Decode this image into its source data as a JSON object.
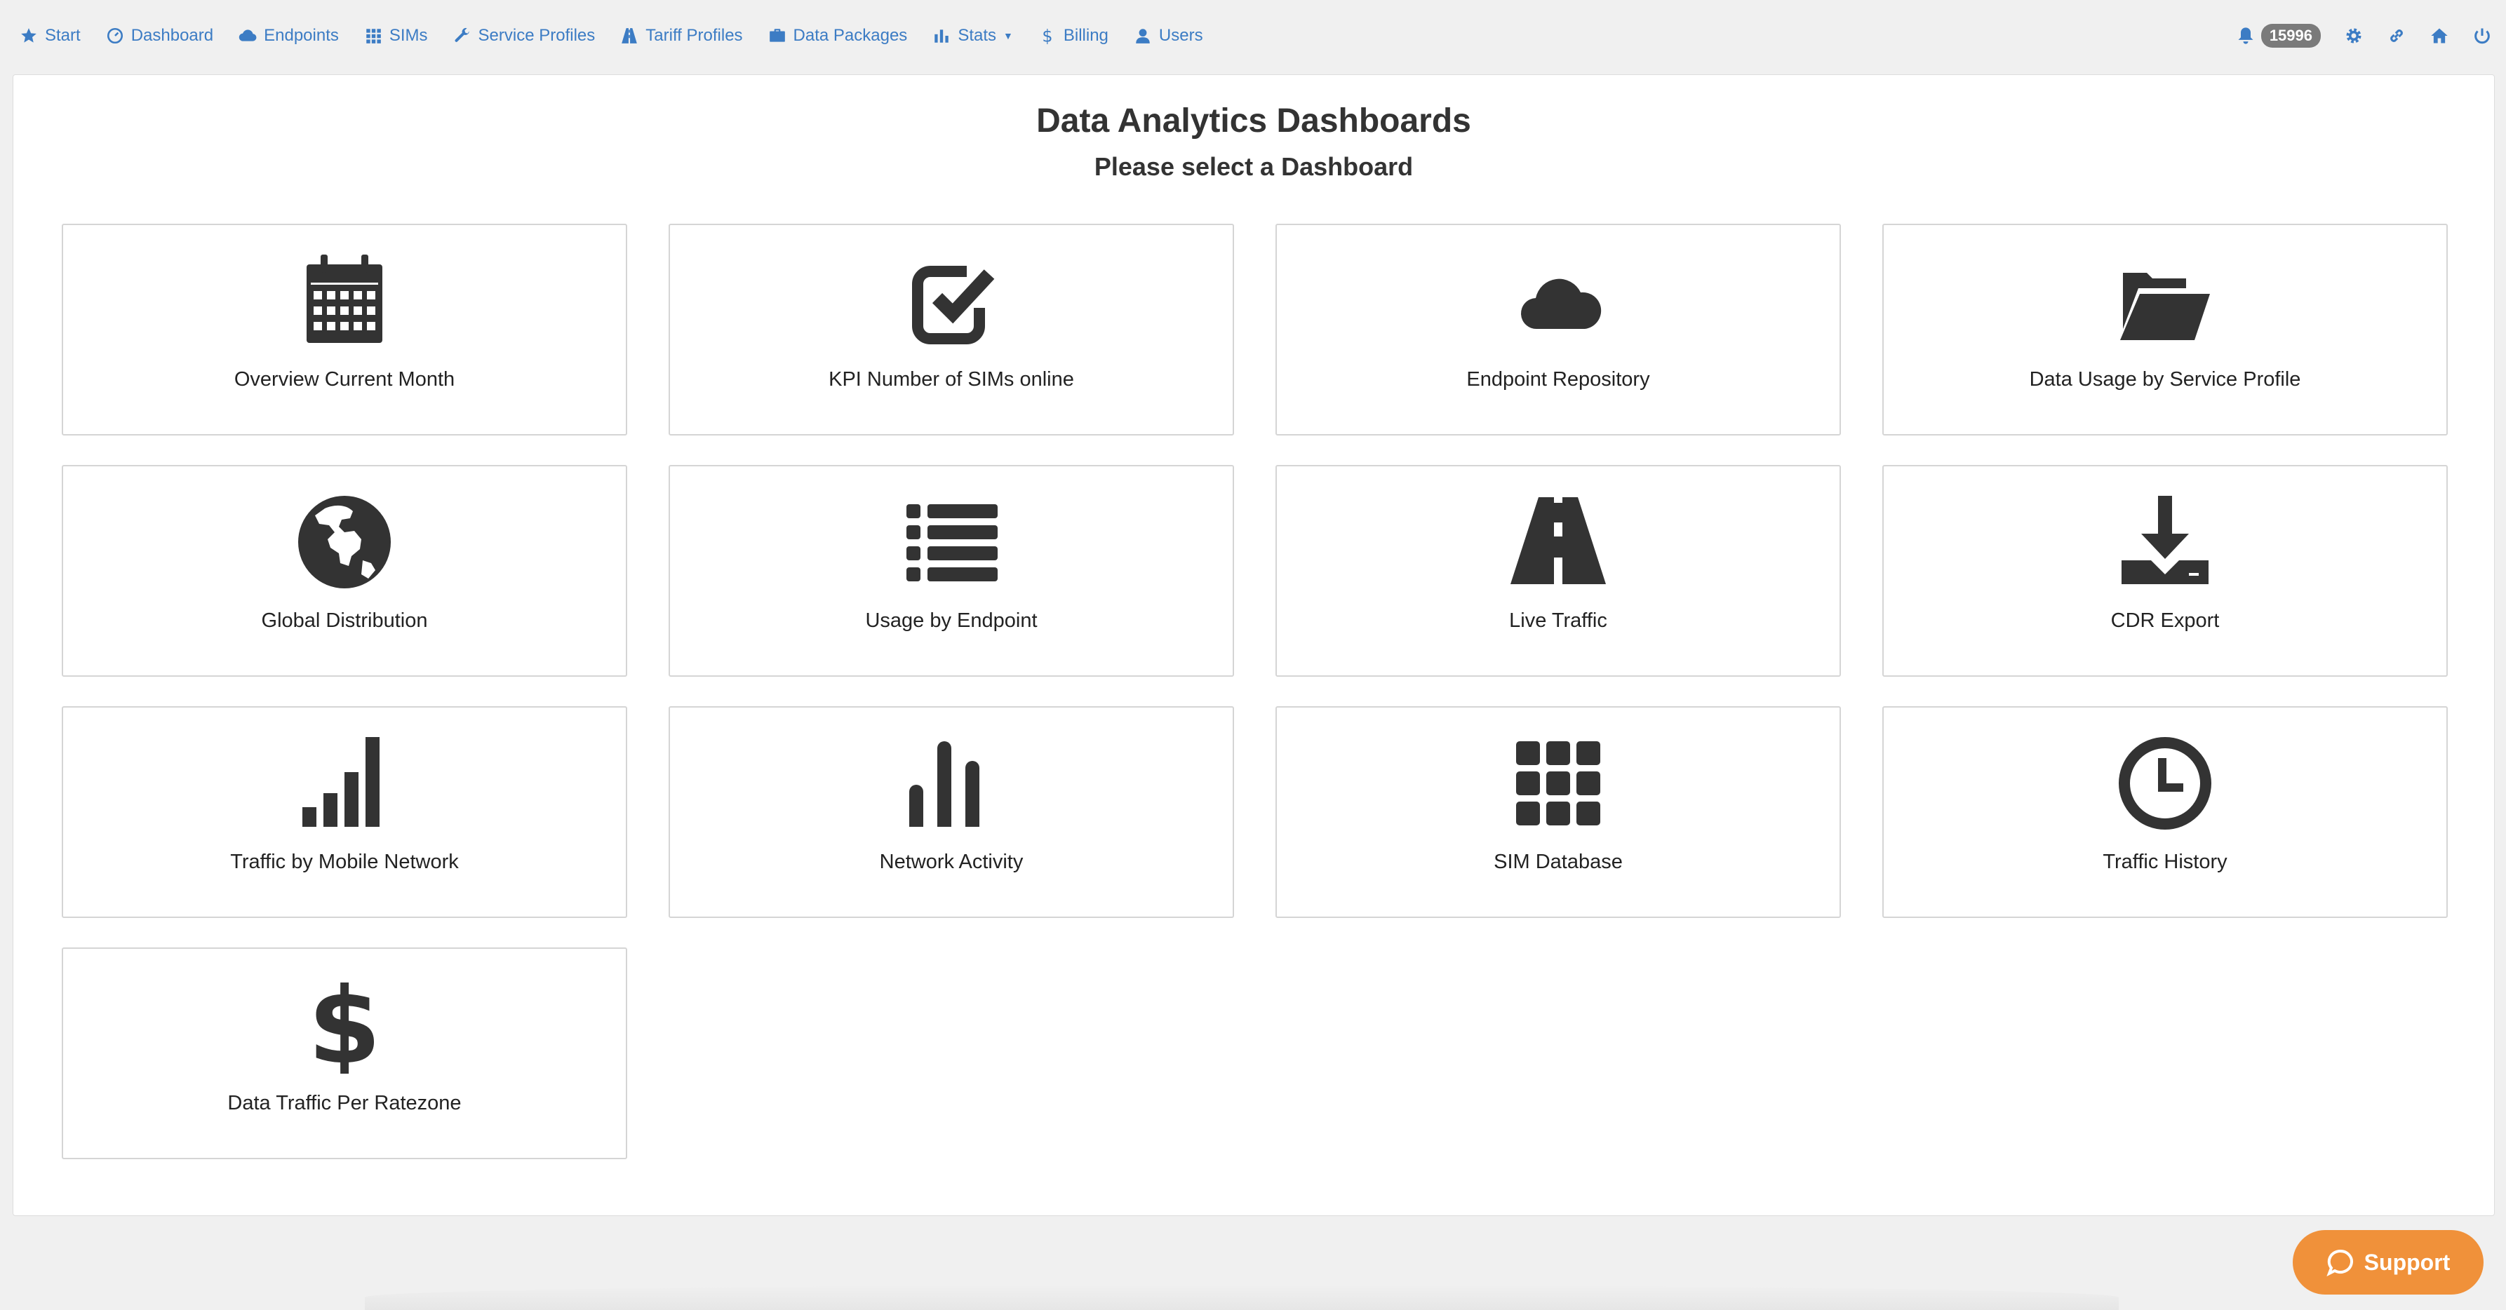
{
  "nav": {
    "items": [
      {
        "label": "Start",
        "icon": "star-icon"
      },
      {
        "label": "Dashboard",
        "icon": "dashboard-icon"
      },
      {
        "label": "Endpoints",
        "icon": "cloud-icon"
      },
      {
        "label": "SIMs",
        "icon": "grid-icon"
      },
      {
        "label": "Service Profiles",
        "icon": "wrench-icon"
      },
      {
        "label": "Tariff Profiles",
        "icon": "road-icon"
      },
      {
        "label": "Data Packages",
        "icon": "briefcase-icon"
      },
      {
        "label": "Stats",
        "icon": "bar-chart-icon"
      },
      {
        "label": "Billing",
        "icon": "dollar-icon"
      },
      {
        "label": "Users",
        "icon": "user-icon"
      }
    ],
    "notification_count": "15996",
    "link_color": "#3c7cc4"
  },
  "page": {
    "title": "Data Analytics Dashboards",
    "subtitle": "Please select a Dashboard"
  },
  "cards": [
    {
      "label": "Overview Current Month",
      "icon": "calendar-icon"
    },
    {
      "label": "KPI Number of SIMs online",
      "icon": "check-square-icon"
    },
    {
      "label": "Endpoint Repository",
      "icon": "cloud-icon"
    },
    {
      "label": "Data Usage by Service Profile",
      "icon": "folder-open-icon"
    },
    {
      "label": "Global Distribution",
      "icon": "globe-icon"
    },
    {
      "label": "Usage by Endpoint",
      "icon": "list-icon"
    },
    {
      "label": "Live Traffic",
      "icon": "road-icon"
    },
    {
      "label": "CDR Export",
      "icon": "download-icon"
    },
    {
      "label": "Traffic by Mobile Network",
      "icon": "signal-icon"
    },
    {
      "label": "Network Activity",
      "icon": "bar-chart-icon"
    },
    {
      "label": "SIM Database",
      "icon": "grid-icon"
    },
    {
      "label": "Traffic History",
      "icon": "clock-icon"
    },
    {
      "label": "Data Traffic Per Ratezone",
      "icon": "dollar-icon"
    }
  ],
  "support": {
    "label": "Support",
    "color": "#f0913a"
  }
}
